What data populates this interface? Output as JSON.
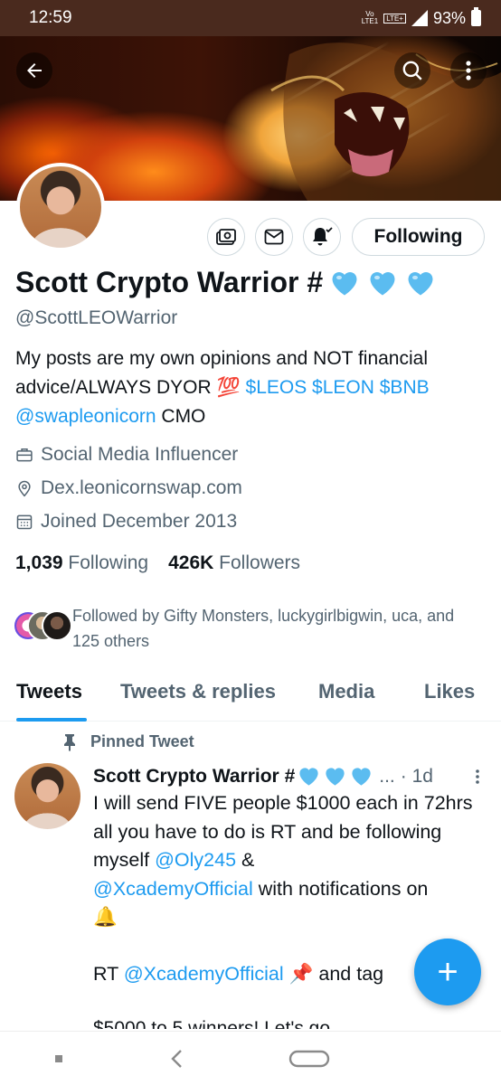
{
  "status_bar": {
    "time": "12:59",
    "network_top": "Vo",
    "network_bottom": "LTE1",
    "lte_badge": "LTE+",
    "battery": "93%"
  },
  "profile": {
    "name": "Scott Crypto Warrior #",
    "handle": "@ScottLEOWarrior",
    "following_button": "Following",
    "bio_text_1": "My posts are my own opinions and NOT financial advice/ALWAYS DYOR ",
    "bio_emoji": "💯",
    "bio_cashtags": "$LEOS $LEON $BNB",
    "bio_mention": "@swapleonicorn",
    "bio_text_2": " CMO",
    "category": "Social Media Influencer",
    "website": "Dex.leonicornswap.com",
    "joined": "Joined December 2013",
    "following_count": "1,039",
    "following_label": "Following",
    "followers_count": "426K",
    "followers_label": "Followers",
    "followed_by": "Followed by Gifty Monsters, luckygirlbigwin, uca, and 125 others"
  },
  "tabs": [
    {
      "label": "Tweets",
      "active": true
    },
    {
      "label": "Tweets & replies",
      "active": false
    },
    {
      "label": "Media",
      "active": false
    },
    {
      "label": "Likes",
      "active": false
    }
  ],
  "tweet": {
    "pinned_label": "Pinned Tweet",
    "author": "Scott Crypto Warrior #",
    "ellipsis": "...",
    "time": "· 1d",
    "line1": "I will send FIVE people $1000 each in 72hrs all you have to do is RT and be following myself ",
    "mention1": "@Oly245",
    "amp": " &",
    "mention2": "@XcademyOfficial",
    "line2": " with notifications on",
    "bell": "🔔",
    "rt_prefix": "RT ",
    "mention3": "@XcademyOfficial",
    "pin_emoji": "📌",
    "rt_suffix": " and tag",
    "cut_line": "$5000 to 5 winners! Let's go"
  },
  "fab": {
    "label": "+"
  },
  "colors": {
    "accent": "#1d9bf0",
    "text": "#0f1419",
    "secondary": "#536471",
    "heart": "#5bbcf0"
  },
  "icons": [
    "back-arrow-icon",
    "search-icon",
    "more-vertical-icon",
    "tip-jar-icon",
    "mail-icon",
    "notification-bell-icon",
    "briefcase-icon",
    "location-pin-icon",
    "calendar-icon",
    "pin-icon",
    "plus-icon"
  ]
}
